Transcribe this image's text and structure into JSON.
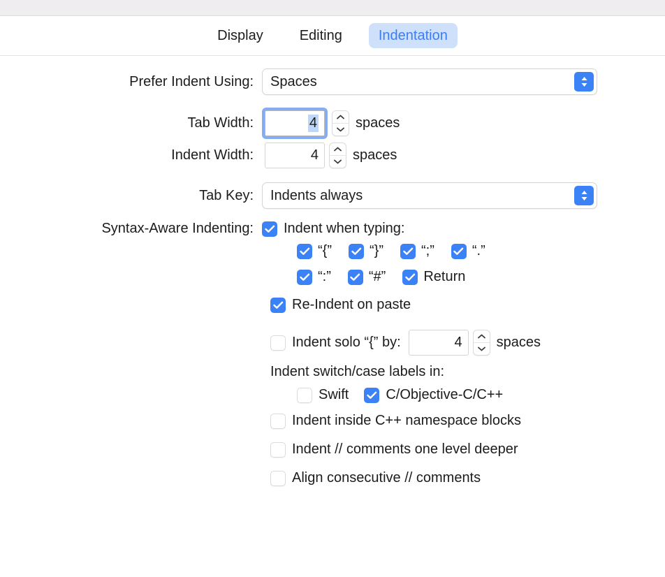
{
  "window": {
    "titlebar_color": "#efedef"
  },
  "tabs": [
    {
      "label": "Display",
      "selected": false
    },
    {
      "label": "Editing",
      "selected": false
    },
    {
      "label": "Indentation",
      "selected": true
    }
  ],
  "colors": {
    "accent_blue": "#3b82f6",
    "tab_selected_bg": "#cfe0fb",
    "tab_selected_text": "#3b7ef3",
    "focus_ring": "#84adf3",
    "text_selection": "#bcd7f7"
  },
  "form": {
    "prefer_indent_using": {
      "label": "Prefer Indent Using:",
      "value": "Spaces"
    },
    "tab_width": {
      "label": "Tab Width:",
      "value": "4",
      "unit": "spaces",
      "focused": true
    },
    "indent_width": {
      "label": "Indent Width:",
      "value": "4",
      "unit": "spaces",
      "focused": false
    },
    "tab_key": {
      "label": "Tab Key:",
      "value": "Indents always"
    },
    "syntax_aware": {
      "label": "Syntax-Aware Indenting:",
      "indent_when_typing": {
        "label": "Indent when typing:",
        "checked": true
      },
      "characters_row1": [
        {
          "label": "“{”",
          "checked": true
        },
        {
          "label": "“}”",
          "checked": true
        },
        {
          "label": "“;”",
          "checked": true
        },
        {
          "label": "“.”",
          "checked": true
        }
      ],
      "characters_row2": [
        {
          "label": "“:”",
          "checked": true
        },
        {
          "label": "“#”",
          "checked": true
        },
        {
          "label": "Return",
          "checked": true
        }
      ],
      "re_indent_on_paste": {
        "label": "Re-Indent on paste",
        "checked": true
      },
      "indent_solo": {
        "label": "Indent solo “{” by:",
        "checked": false,
        "value": "4",
        "unit": "spaces"
      },
      "switch_case_heading": "Indent switch/case labels in:",
      "switch_case_options": [
        {
          "label": "Swift",
          "checked": false
        },
        {
          "label": "C/Objective-C/C++",
          "checked": true
        }
      ],
      "extra_options": [
        {
          "label": "Indent inside C++ namespace blocks",
          "checked": false
        },
        {
          "label": "Indent // comments one level deeper",
          "checked": false
        },
        {
          "label": "Align consecutive // comments",
          "checked": false
        }
      ]
    }
  }
}
